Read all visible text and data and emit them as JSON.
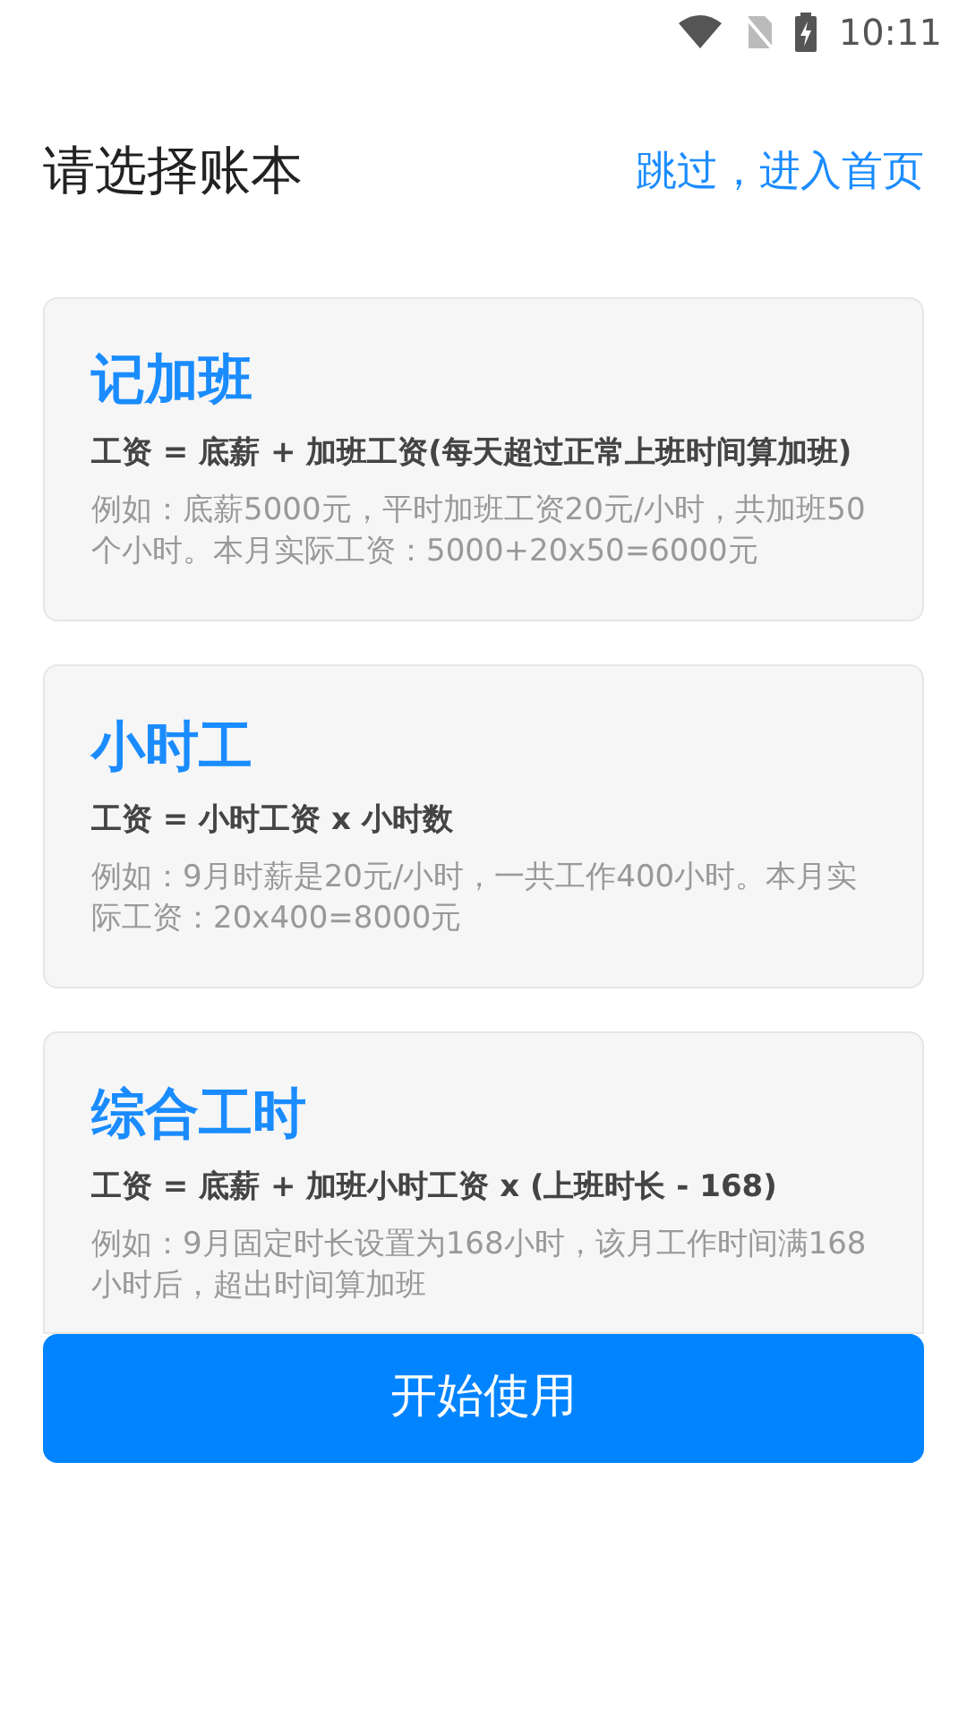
{
  "status_bar": {
    "time": "10:11"
  },
  "header": {
    "title": "请选择账本",
    "skip_link": "跳过，进入首页"
  },
  "cards": [
    {
      "title": "记加班",
      "formula": "工资 = 底薪 + 加班工资(每天超过正常上班时间算加班)",
      "example": "例如：底薪5000元，平时加班工资20元/小时，共加班50个小时。本月实际工资：5000+20x50=6000元"
    },
    {
      "title": "小时工",
      "formula": "工资 = 小时工资 x 小时数",
      "example": "例如：9月时薪是20元/小时，一共工作400小时。本月实际工资：20x400=8000元"
    },
    {
      "title": "综合工时",
      "formula": "工资 = 底薪 + 加班小时工资 x (上班时长 - 168)",
      "example": "例如：9月固定时长设置为168小时，该月工作时间满168小时后，超出时间算加班"
    }
  ],
  "start_button": "开始使用"
}
